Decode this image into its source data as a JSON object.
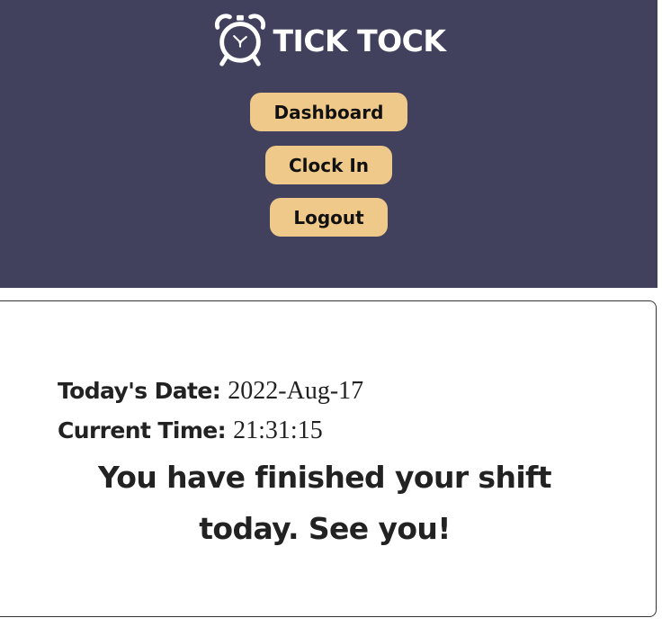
{
  "header": {
    "brand_name": "TICK TOCK",
    "logo_icon": "alarm-clock-icon",
    "background_color": "#41405d",
    "nav": [
      {
        "label": "Dashboard"
      },
      {
        "label": "Clock In"
      },
      {
        "label": "Logout"
      }
    ],
    "button_color": "#efc98a"
  },
  "main": {
    "date_label": "Today's Date:",
    "date_value": "2022-Aug-17",
    "time_label": "Current Time:",
    "time_value": "21:31:15",
    "message": "You have finished your shift today. See you!"
  }
}
